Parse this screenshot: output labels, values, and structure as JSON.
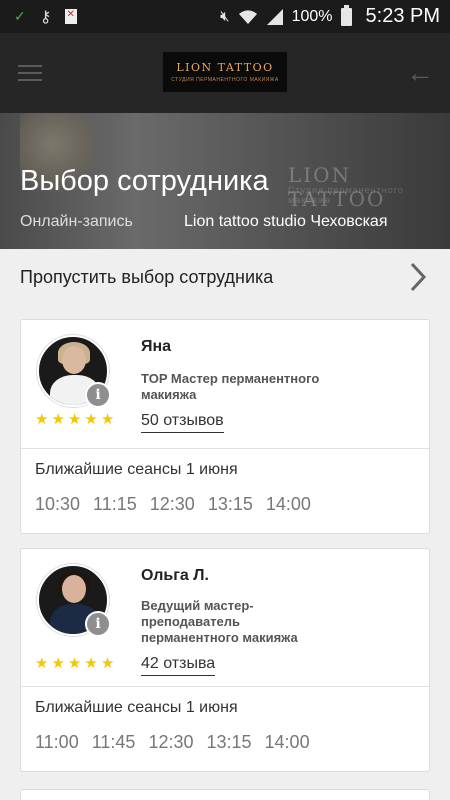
{
  "status_bar": {
    "battery_percent": "100%",
    "time": "5:23 PM",
    "icons": [
      "check-icon",
      "key-icon",
      "file-error-icon",
      "mute-icon",
      "wifi-icon",
      "signal-icon",
      "battery-icon"
    ]
  },
  "app_bar": {
    "logo_title": "LION TATTOO",
    "logo_subtitle": "СТУДИЯ ПЕРМАНЕНТНОГО МАКИЯЖА",
    "menu_icon": "hamburger-icon",
    "back_icon": "arrow-left-icon"
  },
  "hero": {
    "title": "Выбор сотрудника",
    "subtitle_left": "Онлайн-запись",
    "subtitle_right": "Lion tattoo studio Чеховская",
    "watermark": "LION TATTOO",
    "watermark_sub": "Студия перманентного макияжа"
  },
  "skip": {
    "label": "Пропустить выбор сотрудника",
    "icon": "chevron-right-icon"
  },
  "employees": [
    {
      "name": "Яна",
      "role": "TOP Мастер перманентного макияжа",
      "rating": 5,
      "reviews": "50 отзывов",
      "sessions_title": "Ближайшие сеансы 1 июня",
      "slots": [
        "10:30",
        "11:15",
        "12:30",
        "13:15",
        "14:00"
      ]
    },
    {
      "name": "Ольга Л.",
      "role": "Ведущий мастер-преподаватель перманентного макияжа",
      "rating": 5,
      "reviews": "42 отзыва",
      "sessions_title": "Ближайшие сеансы 1 июня",
      "slots": [
        "11:00",
        "11:45",
        "12:30",
        "13:15",
        "14:00"
      ]
    }
  ],
  "colors": {
    "star": "#f6c700",
    "appbar": "#262626",
    "logo_gold": "#e8a55c"
  }
}
